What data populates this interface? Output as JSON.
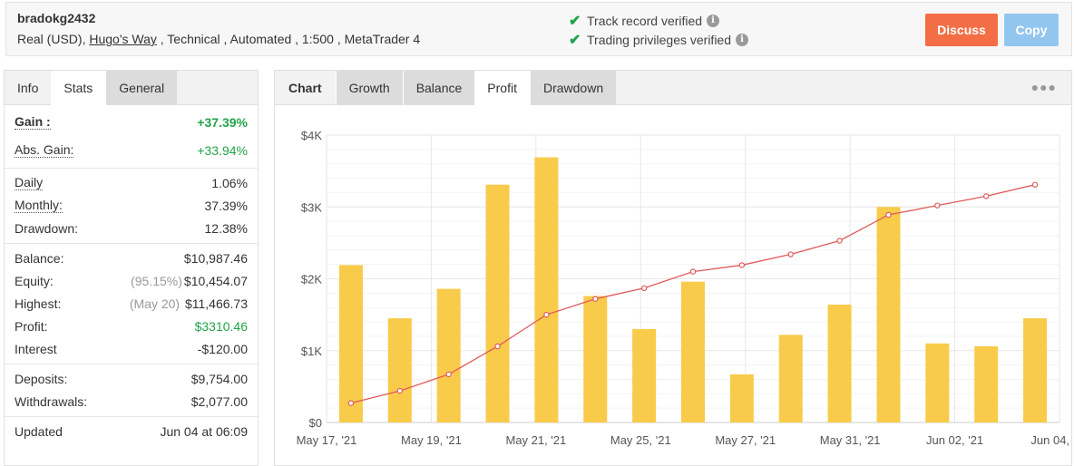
{
  "header": {
    "account_name": "bradokg2432",
    "sub_prefix": "Real (USD), ",
    "broker": "Hugo's Way",
    "sub_suffix": " , Technical , Automated , 1:500 , MetaTrader 4",
    "verified_1": "Track record verified",
    "verified_2": "Trading privileges verified",
    "discuss_label": "Discuss",
    "copy_label": "Copy",
    "colors": {
      "discuss": "#f36e45",
      "copy": "#93c6ef",
      "check": "#21a34a"
    }
  },
  "left_tabs": [
    "Info",
    "Stats",
    "General"
  ],
  "stats": {
    "gain_label": "Gain :",
    "gain_value": "+37.39%",
    "abs_gain_label": "Abs. Gain:",
    "abs_gain_value": "+33.94%",
    "daily_label": "Daily",
    "daily_value": "1.06%",
    "monthly_label": "Monthly:",
    "monthly_value": "37.39%",
    "drawdown_label": "Drawdown:",
    "drawdown_value": "12.38%",
    "balance_label": "Balance:",
    "balance_value": "$10,987.46",
    "equity_label": "Equity:",
    "equity_note": "(95.15%)",
    "equity_value": "$10,454.07",
    "highest_label": "Highest:",
    "highest_note": "(May 20)",
    "highest_value": "$11,466.73",
    "profit_label": "Profit:",
    "profit_value": "$3310.46",
    "interest_label": "Interest",
    "interest_value": "-$120.00",
    "deposits_label": "Deposits:",
    "deposits_value": "$9,754.00",
    "withdrawals_label": "Withdrawals:",
    "withdrawals_value": "$2,077.00",
    "updated_label": "Updated",
    "updated_value": "Jun 04 at 06:09"
  },
  "chart_tabs": [
    "Chart",
    "Growth",
    "Balance",
    "Profit",
    "Drawdown"
  ],
  "active_chart_tab": "Profit",
  "chart_data": {
    "type": "bar",
    "categories": [
      "May 17",
      "May 18",
      "May 19",
      "May 20",
      "May 21",
      "May 24",
      "May 25",
      "May 26",
      "May 27",
      "May 28",
      "May 31",
      "Jun 01",
      "Jun 02",
      "Jun 03",
      "Jun 04"
    ],
    "x_tick_labels": [
      "May 17, '21",
      "May 19, '21",
      "May 21, '21",
      "May 25, '21",
      "May 27, '21",
      "May 31, '21",
      "Jun 02, '21",
      "Jun 04, '21"
    ],
    "y_tick_labels": [
      "$0",
      "$1K",
      "$2K",
      "$3K",
      "$4K"
    ],
    "ylim": [
      0,
      4000
    ],
    "grid": true,
    "series": [
      {
        "type": "bar",
        "color": "#f8cb4a",
        "values": [
          2190,
          1450,
          1860,
          3310,
          3690,
          1760,
          1300,
          1960,
          670,
          1220,
          1640,
          3000,
          1100,
          1060,
          1450
        ]
      },
      {
        "type": "line",
        "color": "#e05b5b",
        "values": [
          270,
          440,
          670,
          1060,
          1500,
          1720,
          1870,
          2100,
          2190,
          2340,
          2530,
          2890,
          3020,
          3150,
          3310
        ]
      }
    ]
  }
}
